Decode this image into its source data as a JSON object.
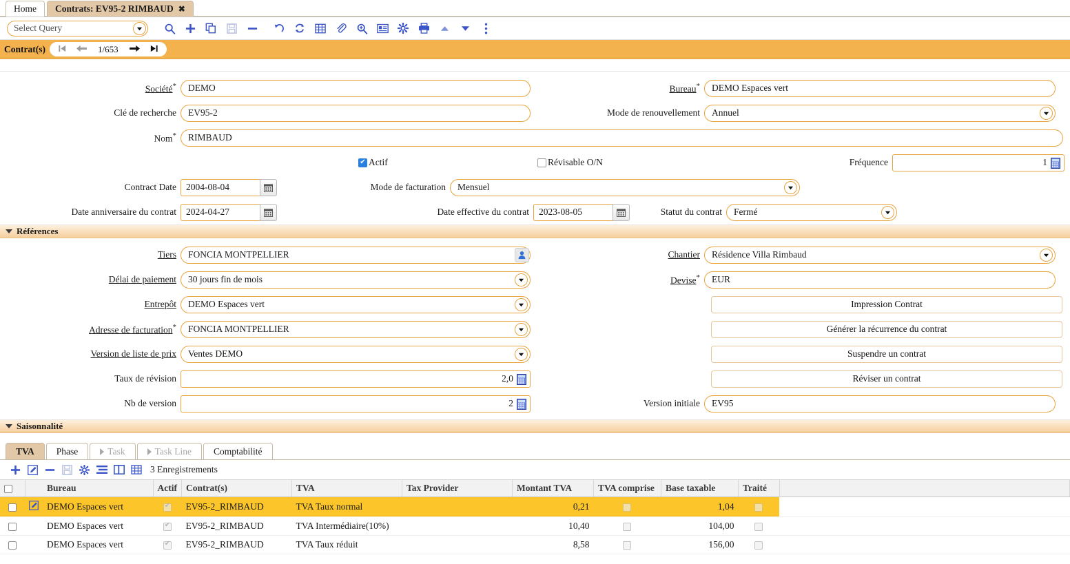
{
  "colors": {
    "accent_orange": "#f3b24d",
    "tab_active": "#e2c8a6",
    "row_selected": "#fcc52a",
    "icon_blue": "#3b55c9"
  },
  "tabs": [
    {
      "label": "Home",
      "active": false,
      "closable": false
    },
    {
      "label": "Contrats: EV95-2 RIMBAUD",
      "active": true,
      "closable": true
    }
  ],
  "toolbar": {
    "query_placeholder": "Select Query",
    "icons": [
      "search-icon",
      "add-icon",
      "copy-icon",
      "save-icon",
      "remove-icon",
      "undo-icon",
      "refresh-icon",
      "grid-icon",
      "attachment-icon",
      "zoom-in-icon",
      "record-card-icon",
      "gear-icon",
      "print-icon",
      "arrow-up-icon",
      "arrow-down-icon",
      "more-vertical-icon"
    ]
  },
  "nav": {
    "label": "Contrat(s)",
    "first": "⏮",
    "prev": "←",
    "position": "1/653",
    "next": "→",
    "last": "⏭"
  },
  "form": {
    "societe": {
      "label": "Société",
      "required": true,
      "value": "DEMO"
    },
    "bureau": {
      "label": "Bureau",
      "required": true,
      "value": "DEMO Espaces vert"
    },
    "cle_recherche": {
      "label": "Clé de recherche",
      "value": "EV95-2"
    },
    "mode_renouvellement": {
      "label": "Mode de renouvellement",
      "value": "Annuel"
    },
    "nom": {
      "label": "Nom",
      "required": true,
      "value": "RIMBAUD"
    },
    "actif": {
      "label": "Actif",
      "checked": true
    },
    "revisable": {
      "label": "Révisable O/N",
      "checked": false
    },
    "frequence": {
      "label": "Fréquence",
      "value": "1"
    },
    "contract_date": {
      "label": "Contract Date",
      "value": "2004-08-04"
    },
    "mode_facturation": {
      "label": "Mode de facturation",
      "value": "Mensuel"
    },
    "date_anniversaire": {
      "label": "Date anniversaire du contrat",
      "value": "2024-04-27"
    },
    "date_effective": {
      "label": "Date effective du contrat",
      "value": "2023-08-05"
    },
    "statut_contrat": {
      "label": "Statut du contrat",
      "value": "Fermé"
    }
  },
  "references": {
    "title": "Références",
    "tiers": {
      "label": "Tiers",
      "value": "FONCIA MONTPELLIER"
    },
    "chantier": {
      "label": "Chantier",
      "value": "Résidence Villa Rimbaud"
    },
    "delai_paiement": {
      "label": "Délai de paiement",
      "value": "30 jours fin de mois"
    },
    "devise": {
      "label": "Devise",
      "required": true,
      "value": "EUR"
    },
    "entrepot": {
      "label": "Entrepôt",
      "value": "DEMO Espaces vert"
    },
    "adresse_facturation": {
      "label": "Adresse de facturation",
      "required": true,
      "value": "FONCIA MONTPELLIER"
    },
    "version_liste_prix": {
      "label": "Version de liste de prix",
      "value": "Ventes DEMO"
    },
    "taux_revision": {
      "label": "Taux de révision",
      "value": "2,0"
    },
    "nb_version": {
      "label": "Nb de version",
      "value": "2"
    },
    "version_initiale": {
      "label": "Version initiale",
      "value": "EV95"
    },
    "buttons": [
      "Impression Contrat",
      "Générer la récurrence du contrat",
      "Suspendre un contrat",
      "Réviser un contrat"
    ]
  },
  "saisonnalite": {
    "title": "Saisonnalité"
  },
  "grid_panel": {
    "tabs": [
      {
        "label": "TVA",
        "active": true,
        "disabled": false
      },
      {
        "label": "Phase",
        "active": false,
        "disabled": false
      },
      {
        "label": "Task",
        "active": false,
        "disabled": true
      },
      {
        "label": "Task Line",
        "active": false,
        "disabled": true
      },
      {
        "label": "Comptabilité",
        "active": false,
        "disabled": false
      }
    ],
    "toolbar_icons": [
      "add-icon",
      "edit-icon",
      "remove-icon",
      "save-icon",
      "gear-icon",
      "list-view-icon",
      "split-view-icon",
      "table-view-icon"
    ],
    "record_count": "3 Enregistrements",
    "columns": [
      "Bureau",
      "Actif",
      "Contrat(s)",
      "TVA",
      "Tax Provider",
      "Montant TVA",
      "TVA comprise",
      "Base taxable",
      "Traité"
    ],
    "rows": [
      {
        "selected": true,
        "bureau": "DEMO Espaces vert",
        "actif": true,
        "contrat": "EV95-2_RIMBAUD",
        "tva": "TVA Taux normal",
        "tax_provider": "",
        "montant_tva": "0,21",
        "tva_comprise": false,
        "base_taxable": "1,04",
        "traite": false
      },
      {
        "selected": false,
        "bureau": "DEMO Espaces vert",
        "actif": true,
        "contrat": "EV95-2_RIMBAUD",
        "tva": "TVA Intermédiaire(10%)",
        "tax_provider": "",
        "montant_tva": "10,40",
        "tva_comprise": false,
        "base_taxable": "104,00",
        "traite": false
      },
      {
        "selected": false,
        "bureau": "DEMO Espaces vert",
        "actif": true,
        "contrat": "EV95-2_RIMBAUD",
        "tva": "TVA Taux réduit",
        "tax_provider": "",
        "montant_tva": "8,58",
        "tva_comprise": false,
        "base_taxable": "156,00",
        "traite": false
      }
    ]
  }
}
